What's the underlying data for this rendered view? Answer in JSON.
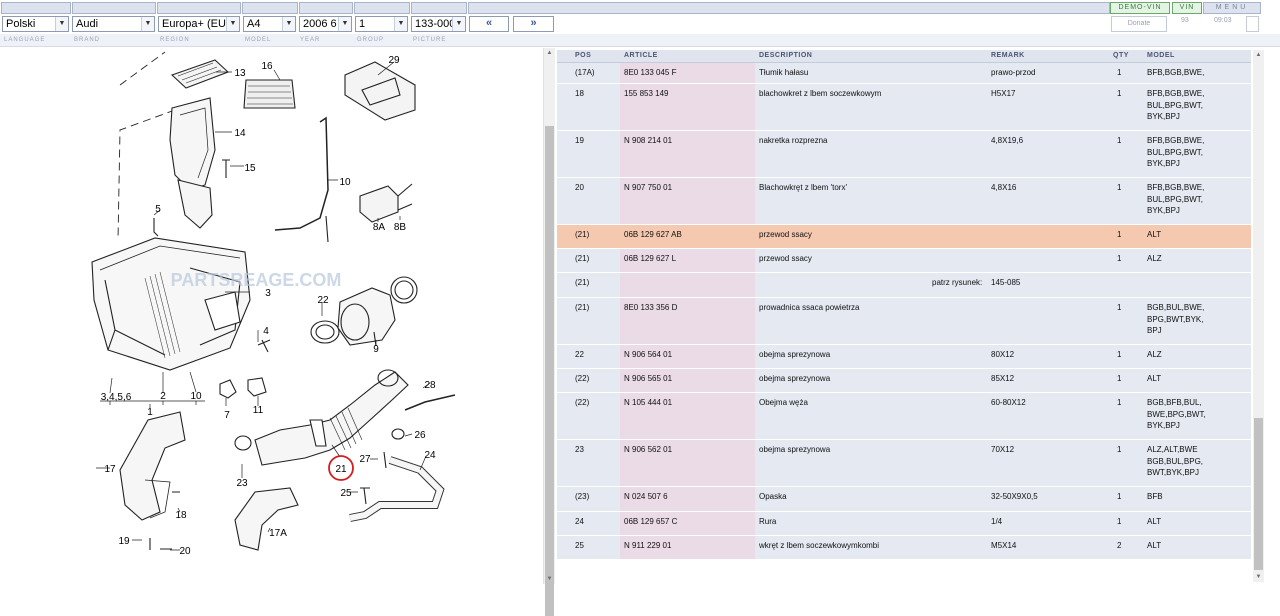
{
  "toolbar": {
    "selects": [
      {
        "value": "Polski"
      },
      {
        "value": "Audi"
      },
      {
        "value": "Europa+ (EU)"
      },
      {
        "value": "A4"
      },
      {
        "value": "2006 6"
      },
      {
        "value": "1"
      },
      {
        "value": "133-000"
      }
    ],
    "prev_label": "«",
    "next_label": "»",
    "donate_label": "Donate",
    "counter": "93",
    "clock": "09:03",
    "demo_vin_label": "DEMO-VIN",
    "vin_label": "VIN",
    "menu_label": "MENU"
  },
  "labels": [
    "LANGUAGE",
    "BRAND",
    "REGION",
    "MODEL",
    "YEAR",
    "GROUP",
    "PICTURE"
  ],
  "diagram": {
    "watermark": "PARTSREAGE.COM",
    "callouts": [
      "13",
      "16",
      "29",
      "14",
      "15",
      "10",
      "5",
      "8A",
      "8B",
      "3",
      "22",
      "4",
      "9",
      "3,4,5,6",
      "2",
      "10",
      "1",
      "7",
      "11",
      "28",
      "26",
      "17",
      "21",
      "27",
      "24",
      "23",
      "18",
      "25",
      "17A",
      "19",
      "20"
    ]
  },
  "table": {
    "columns": [
      "POS",
      "ARTICLE",
      "DESCRIPTION",
      "REMARK",
      "QTY",
      "MODEL"
    ],
    "highlight_color": "#f5c9b0",
    "rows": [
      {
        "pos": "(17A)",
        "article": "8E0 133 045 F",
        "desc": "Tłumik hałasu",
        "remark": "prawo-przod",
        "qty": "1",
        "model": "BFB,BGB,BWE,",
        "highlight": false
      },
      {
        "pos": "18",
        "article": "155 853 149",
        "desc": "blachowkret z lbem soczewkowym",
        "remark": "H5X17",
        "qty": "1",
        "model": "BFB,BGB,BWE,\nBUL,BPG,BWT,\nBYK,BPJ",
        "highlight": false
      },
      {
        "pos": "19",
        "article": "N  908 214 01",
        "desc": "nakretka rozprezna",
        "remark": "4,8X19,6",
        "qty": "1",
        "model": "BFB,BGB,BWE,\nBUL,BPG,BWT,\nBYK,BPJ",
        "highlight": false
      },
      {
        "pos": "20",
        "article": "N  907 750 01",
        "desc": "Blachowkręt z lbem 'torx'",
        "remark": "4,8X16",
        "qty": "1",
        "model": "BFB,BGB,BWE,\nBUL,BPG,BWT,\nBYK,BPJ",
        "highlight": false
      },
      {
        "pos": "(21)",
        "article": "06B 129 627 AB",
        "desc": "przewod ssacy",
        "remark": "",
        "qty": "1",
        "model": "ALT",
        "highlight": true
      },
      {
        "pos": "(21)",
        "article": "06B 129 627 L",
        "desc": "przewod ssacy",
        "remark": "",
        "qty": "1",
        "model": "ALZ",
        "highlight": false
      },
      {
        "pos": "(21)",
        "article": "",
        "desc": "",
        "remark": "",
        "qty": "",
        "model": "",
        "note_label": "patrz rysunek:",
        "note_value": "145-085",
        "highlight": false
      },
      {
        "pos": "(21)",
        "article": "8E0 133 356 D",
        "desc": "prowadnica ssaca powietrza",
        "remark": "",
        "qty": "1",
        "model": "BGB,BUL,BWE,\nBPG,BWT,BYK,\nBPJ",
        "highlight": false
      },
      {
        "pos": "22",
        "article": "N  906 564 01",
        "desc": "obejma sprezynowa",
        "remark": "80X12",
        "qty": "1",
        "model": "ALZ",
        "highlight": false
      },
      {
        "pos": "(22)",
        "article": "N  906 565 01",
        "desc": "obejma sprezynowa",
        "remark": "85X12",
        "qty": "1",
        "model": "ALT",
        "highlight": false
      },
      {
        "pos": "(22)",
        "article": "N  105 444 01",
        "desc": "Obejma węża",
        "remark": "60-80X12",
        "qty": "1",
        "model": "BGB,BFB,BUL,\nBWE,BPG,BWT,\nBYK,BPJ",
        "highlight": false
      },
      {
        "pos": "23",
        "article": "N  906 562 01",
        "desc": "obejma sprezynowa",
        "remark": "70X12",
        "qty": "1",
        "model": "ALZ,ALT,BWE\nBGB,BUL,BPG,\nBWT,BYK,BPJ",
        "highlight": false
      },
      {
        "pos": "(23)",
        "article": "N  024 507 6",
        "desc": "Opaska",
        "remark": "32-50X9X0,5",
        "qty": "1",
        "model": "BFB",
        "highlight": false
      },
      {
        "pos": "24",
        "article": "06B 129 657 C",
        "desc": "Rura",
        "remark": "1/4",
        "qty": "1",
        "model": "ALT",
        "highlight": false
      },
      {
        "pos": "25",
        "article": "N  911 229 01",
        "desc": "wkręt z lbem soczewkowymkombi",
        "remark": "M5X14",
        "qty": "2",
        "model": "ALT",
        "highlight": false
      }
    ]
  }
}
